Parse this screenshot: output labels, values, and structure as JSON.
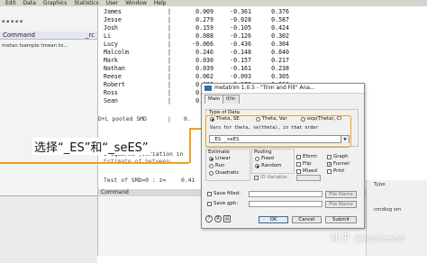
{
  "menubar": [
    "Edit",
    "Data",
    "Graphics",
    "Statistics",
    "User",
    "Window",
    "Help"
  ],
  "left_panel": {
    "title": "Command",
    "shortcut": "_rc",
    "item": "metan tsample tmean to..."
  },
  "results_table": {
    "rows": [
      {
        "name": "James",
        "v1": "0.009",
        "v2": "-0.361",
        "v3": "0.376"
      },
      {
        "name": "Jesse",
        "v1": "0.279",
        "v2": "-0.028",
        "v3": "0.587"
      },
      {
        "name": "Josh",
        "v1": "0.159",
        "v2": "-0.105",
        "v3": "0.424"
      },
      {
        "name": "Li",
        "v1": "0.088",
        "v2": "-0.126",
        "v3": "0.302"
      },
      {
        "name": "Lucy",
        "v1": "-0.066",
        "v2": "-0.436",
        "v3": "0.304"
      },
      {
        "name": "Malcolm",
        "v1": "0.246",
        "v2": "-0.148",
        "v3": "0.640"
      },
      {
        "name": "Mark",
        "v1": "0.030",
        "v2": "-0.157",
        "v3": "0.217"
      },
      {
        "name": "Nathan",
        "v1": "0.039",
        "v2": "-0.161",
        "v3": "0.238"
      },
      {
        "name": "Reese",
        "v1": "0.062",
        "v2": "-0.093",
        "v3": "0.305"
      },
      {
        "name": "Robert",
        "v1": "0.023",
        "v2": "-0.172",
        "v3": "0.210"
      },
      {
        "name": "Ross",
        "v1": "0.058",
        "v2": "-0.183",
        "v3": "0.294"
      },
      {
        "name": "Sean",
        "v1": "0.011",
        "v2": "-0.289",
        "v3": "0.317"
      }
    ],
    "pooled": "D+L pooled SMD",
    "pooled_v1": "0.",
    "heterogeneity_1": "I-squared (variation in",
    "heterogeneity_2": "Estimate of between-",
    "test_label": "Test of SMD=0 : z=",
    "test_value": "0.41"
  },
  "command_header": "Command",
  "right_panel": {
    "items": [
      "Type",
      "",
      "cmdlog sm"
    ]
  },
  "dialog": {
    "title": "metatrim 1.0.5 - \"Trim and Fill\" Ana...",
    "tabs": [
      "Main",
      "if/in"
    ],
    "type_of_data_label": "Type of Data",
    "data_options": [
      "Theta, SE",
      "Theta, Var",
      "exp(Theta), CI"
    ],
    "selected_data": "Theta, SE",
    "vars_label": "Vars for theta, se(theta), in that order",
    "vars_value": "_ES _seES",
    "estimate_label": "Estimate",
    "estimate_options": [
      "Linear",
      "Run",
      "Quadratic"
    ],
    "pooling_label": "Pooling",
    "pooling_options": [
      "Fixed",
      "Random"
    ],
    "id_variable_label": "ID Variable:",
    "checkboxes": [
      {
        "label": "Eform",
        "checked": false
      },
      {
        "label": "Graph",
        "checked": false
      },
      {
        "label": "Flip",
        "checked": false
      },
      {
        "label": "Funnel",
        "checked": true
      },
      {
        "label": "Mixed",
        "checked": false
      },
      {
        "label": "Print",
        "checked": false
      }
    ],
    "save_filled_label": "Save filled:",
    "save_gph_label": "Save gph:",
    "file_name_button": "File Name",
    "buttons": {
      "ok": "OK",
      "cancel": "Cancel",
      "submit": "Submit"
    },
    "icon_buttons": [
      "?",
      "R",
      "copy"
    ]
  },
  "annotation": "选择“_ES”和“_seES”",
  "watermark": "知乎 @Josieeee",
  "colors": {
    "highlight": "#f0a020",
    "selection": "#2e6fb3"
  }
}
